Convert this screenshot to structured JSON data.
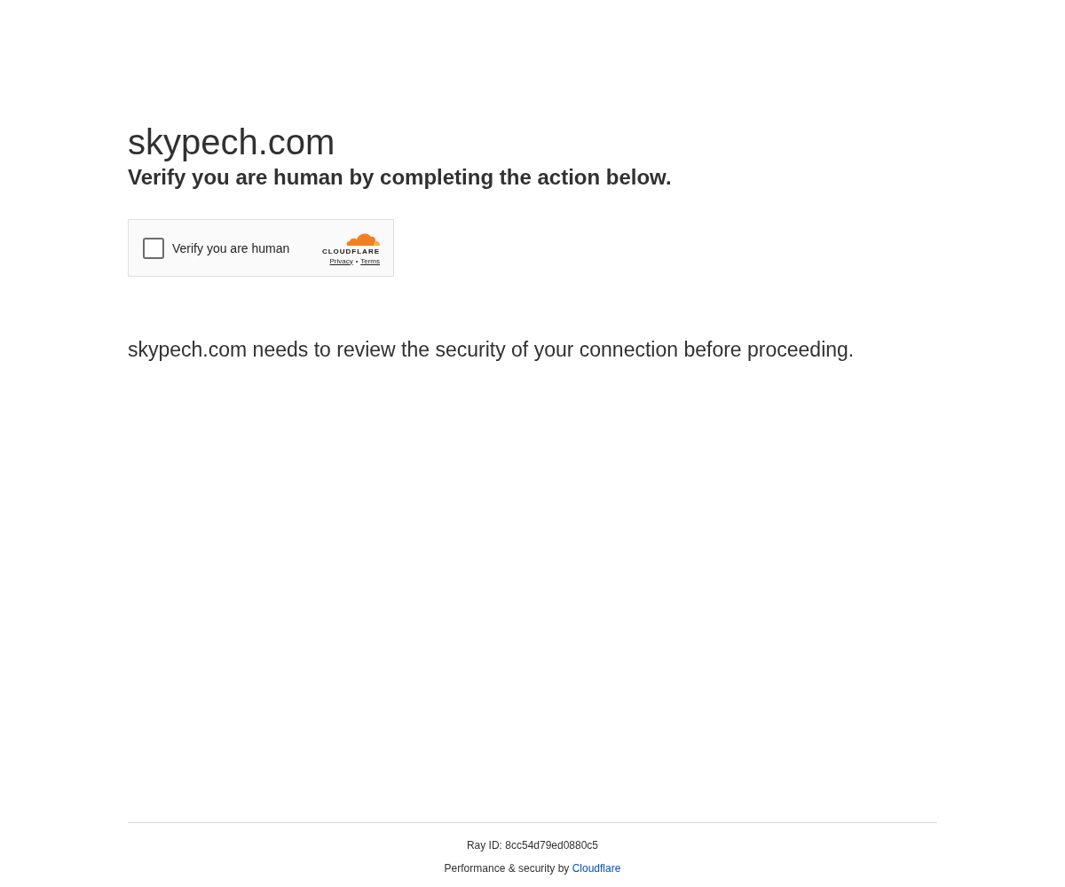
{
  "page": {
    "title": "skypech.com",
    "subtitle": "Verify you are human by completing the action below."
  },
  "challenge": {
    "checkbox": {
      "label": "Verify you are human",
      "checked": false
    },
    "brand": "CLOUDFLARE",
    "links": [
      {
        "label": "Privacy"
      },
      {
        "label": "Terms"
      }
    ],
    "separator": "•"
  },
  "message": "skypech.com needs to review the security of your connection before proceeding.",
  "footer": {
    "ray_id": "Ray ID: 8cc54d79ed0880c5",
    "credit": "Performance & security by",
    "credit_link": "Cloudflare"
  }
}
